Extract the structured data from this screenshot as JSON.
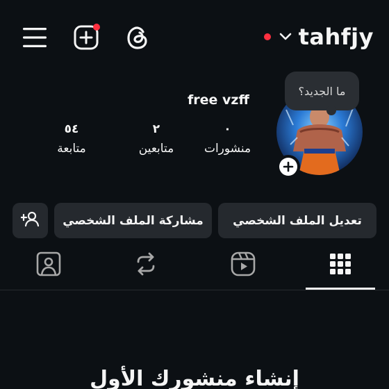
{
  "header": {
    "username": "tahfjy",
    "icons": [
      "hamburger-menu-icon",
      "create-plus-icon",
      "threads-icon",
      "chevron-down-icon"
    ],
    "notification_color": "#ff3040"
  },
  "profile": {
    "display_name": "free vzff",
    "note_text": "ما الجديد؟",
    "avatar": "avatar-image",
    "stats": {
      "posts": {
        "value": "٠",
        "label": "منشورات"
      },
      "followers": {
        "value": "٢",
        "label": "متابعين"
      },
      "following": {
        "value": "٥٤",
        "label": "متابعة"
      }
    }
  },
  "actions": {
    "edit_profile": "تعديل الملف الشخصي",
    "share_profile": "مشاركة الملف الشخصي",
    "discover_people_icon": "add-person-icon"
  },
  "tabs": [
    {
      "icon": "grid-icon",
      "selected": true
    },
    {
      "icon": "reels-icon",
      "selected": false
    },
    {
      "icon": "reposts-icon",
      "selected": false
    },
    {
      "icon": "tagged-icon",
      "selected": false
    }
  ],
  "content": {
    "empty_title": "إنشاء منشورك الأول"
  },
  "colors": {
    "background": "#0c1014",
    "button": "#25292e",
    "text": "#f5f5f5"
  }
}
